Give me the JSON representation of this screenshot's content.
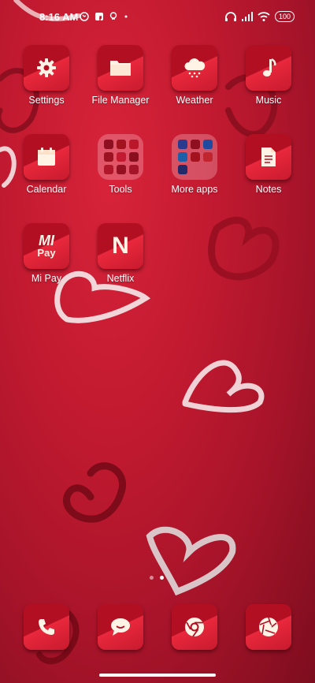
{
  "status_bar": {
    "time": "8:16 AM",
    "battery": "100",
    "left_icons": [
      "whatsapp-icon",
      "facebook-icon",
      "maps-icon",
      "more-dot-icon"
    ],
    "right_icons": [
      "headphones-icon",
      "signal-icon",
      "wifi-icon",
      "battery-icon"
    ]
  },
  "apps": [
    {
      "label": "Settings",
      "icon": "gear-icon"
    },
    {
      "label": "File Manager",
      "icon": "folder-icon"
    },
    {
      "label": "Weather",
      "icon": "cloud-icon"
    },
    {
      "label": "Music",
      "icon": "music-note-icon"
    },
    {
      "label": "Calendar",
      "icon": "calendar-icon"
    },
    {
      "label": "Tools",
      "icon": "folder-grid-icon"
    },
    {
      "label": "More apps",
      "icon": "folder-grid-icon"
    },
    {
      "label": "Notes",
      "icon": "document-icon"
    },
    {
      "label": "Mi Pay",
      "icon": "mi-pay-icon",
      "icon_text_top": "MI",
      "icon_text_bottom": "Pay"
    },
    {
      "label": "Netflix",
      "icon": "netflix-icon",
      "icon_text": "N"
    }
  ],
  "dock": [
    {
      "icon": "phone-icon"
    },
    {
      "icon": "message-icon"
    },
    {
      "icon": "chrome-icon"
    },
    {
      "icon": "camera-icon"
    }
  ],
  "page_indicator": {
    "pages": 2,
    "current": 2
  },
  "colors": {
    "accent": "#d11f35",
    "tile_dark": "#b30f23",
    "glyph": "#fff3e6"
  }
}
